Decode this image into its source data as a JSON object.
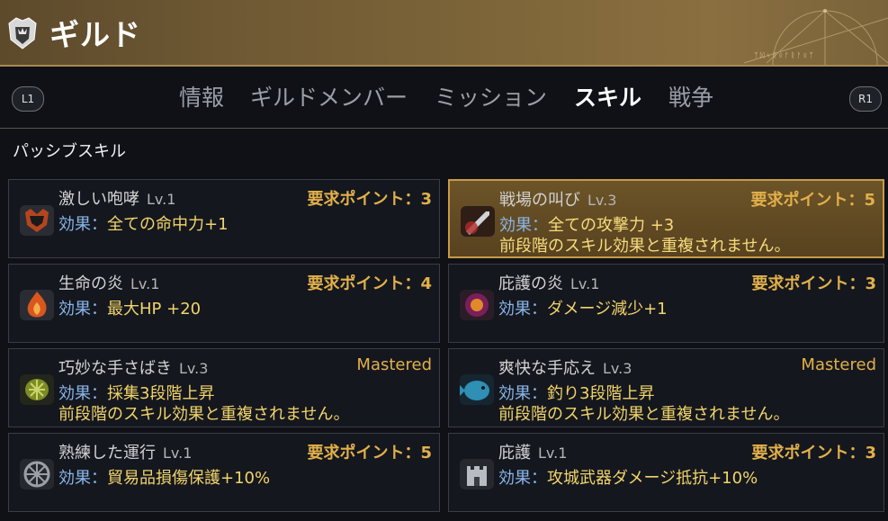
{
  "header": {
    "title": "ギルド",
    "deco_text": "ᛉᛞᛃᛝᛟᚨᚱᚨᛟᛉ"
  },
  "nav": {
    "left_shoulder": "L1",
    "right_shoulder": "R1",
    "tabs": [
      {
        "label": "情報",
        "active": false
      },
      {
        "label": "ギルドメンバー",
        "active": false
      },
      {
        "label": "ミッション",
        "active": false
      },
      {
        "label": "スキル",
        "active": true
      },
      {
        "label": "戦争",
        "active": false
      }
    ]
  },
  "section": {
    "title": "パッシブスキル"
  },
  "skills": [
    {
      "name": "激しい咆哮",
      "level": "Lv.1",
      "requirement": "要求ポイント：3",
      "effect_label": "効果：",
      "effect_value": "全ての命中力+1",
      "note": "",
      "icon": "roar-icon",
      "selected": false
    },
    {
      "name": "戦場の叫び",
      "level": "Lv.3",
      "requirement": "要求ポイント：5",
      "effect_label": "効果：",
      "effect_value": "全ての攻撃力 +3",
      "note": "前段階のスキル効果と重複されません。",
      "icon": "battle-cry-icon",
      "selected": true
    },
    {
      "name": "生命の炎",
      "level": "Lv.1",
      "requirement": "要求ポイント：4",
      "effect_label": "効果：",
      "effect_value": "最大HP +20",
      "note": "",
      "icon": "life-flame-icon",
      "selected": false
    },
    {
      "name": "庇護の炎",
      "level": "Lv.1",
      "requirement": "要求ポイント：3",
      "effect_label": "効果：",
      "effect_value": "ダメージ減少+1",
      "note": "",
      "icon": "protect-flame-icon",
      "selected": false
    },
    {
      "name": "巧妙な手さばき",
      "level": "Lv.3",
      "requirement": "Mastered",
      "effect_label": "効果：",
      "effect_value": "採集3段階上昇",
      "note": "前段階のスキル効果と重複されません。",
      "icon": "gathering-icon",
      "selected": false
    },
    {
      "name": "爽快な手応え",
      "level": "Lv.3",
      "requirement": "Mastered",
      "effect_label": "効果：",
      "effect_value": "釣り3段階上昇",
      "note": "前段階のスキル効果と重複されません。",
      "icon": "fishing-icon",
      "selected": false
    },
    {
      "name": "熟練した運行",
      "level": "Lv.1",
      "requirement": "要求ポイント：5",
      "effect_label": "効果：",
      "effect_value": "貿易品損傷保護+10%",
      "note": "",
      "icon": "wheel-icon",
      "selected": false
    },
    {
      "name": "庇護",
      "level": "Lv.1",
      "requirement": "要求ポイント：3",
      "effect_label": "効果：",
      "effect_value": "攻城武器ダメージ抵抗+10%",
      "note": "",
      "icon": "fortress-icon",
      "selected": false
    }
  ]
}
